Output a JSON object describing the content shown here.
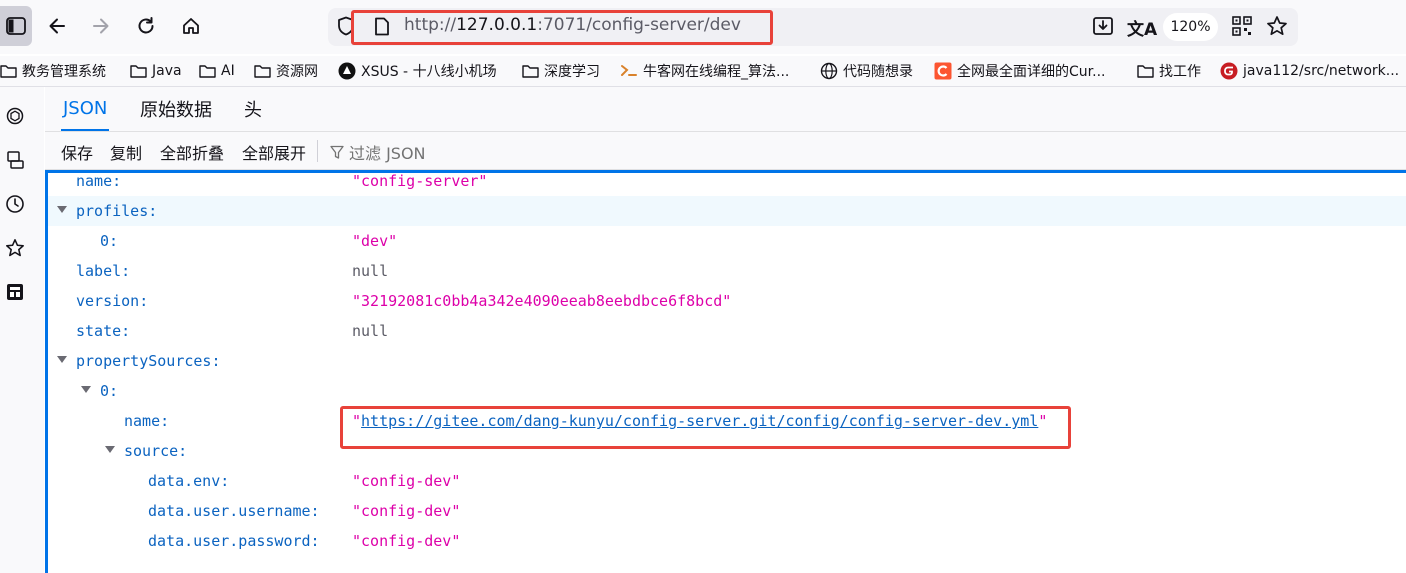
{
  "browser": {
    "url_prefix": "http://",
    "url_host": "127.0.0.1",
    "url_rest": ":7071/config-server/dev",
    "zoom": "120%"
  },
  "bookmarks": [
    {
      "label": "教务管理系统",
      "icon": "folder-icon"
    },
    {
      "label": "Java",
      "icon": "folder-icon"
    },
    {
      "label": "AI",
      "icon": "folder-icon"
    },
    {
      "label": "资源网",
      "icon": "folder-icon"
    },
    {
      "label": "XSUS - 十八线小机场",
      "icon": "xsus-logo-icon"
    },
    {
      "label": "深度学习",
      "icon": "folder-icon"
    },
    {
      "label": "牛客网在线编程_算法...",
      "icon": "nowcoder-icon"
    },
    {
      "label": "代码随想录",
      "icon": "globe-icon"
    },
    {
      "label": "全网最全面详细的Cur...",
      "icon": "csdn-icon"
    },
    {
      "label": "找工作",
      "icon": "folder-icon"
    },
    {
      "label": "java112/src/network...",
      "icon": "gitee-icon"
    }
  ],
  "viewer": {
    "tabs": [
      "JSON",
      "原始数据",
      "头"
    ],
    "actions": [
      "保存",
      "复制",
      "全部折叠",
      "全部展开"
    ],
    "filter_placeholder": "过滤 JSON"
  },
  "json_rows": [
    {
      "key": "name:",
      "value": "\"config-server\"",
      "type": "string",
      "depth": 0,
      "expandable": false
    },
    {
      "key": "profiles:",
      "value": "",
      "type": "none",
      "depth": 0,
      "expandable": true
    },
    {
      "key": "0:",
      "value": "\"dev\"",
      "type": "string",
      "depth": 1,
      "expandable": false
    },
    {
      "key": "label:",
      "value": "null",
      "type": "null",
      "depth": 0,
      "expandable": false
    },
    {
      "key": "version:",
      "value": "\"32192081c0bb4a342e4090eeab8eebdbce6f8bcd\"",
      "type": "string",
      "depth": 0,
      "expandable": false
    },
    {
      "key": "state:",
      "value": "null",
      "type": "null",
      "depth": 0,
      "expandable": false
    },
    {
      "key": "propertySources:",
      "value": "",
      "type": "none",
      "depth": 0,
      "expandable": true
    },
    {
      "key": "0:",
      "value": "",
      "type": "none",
      "depth": 1,
      "expandable": true
    },
    {
      "key": "name:",
      "value": "https://gitee.com/dang-kunyu/config-server.git/config/config-server-dev.yml",
      "type": "link",
      "depth": 2,
      "expandable": false
    },
    {
      "key": "source:",
      "value": "",
      "type": "none",
      "depth": 2,
      "expandable": true
    },
    {
      "key": "data.env:",
      "value": "\"config-dev\"",
      "type": "string",
      "depth": 3,
      "expandable": false
    },
    {
      "key": "data.user.username:",
      "value": "\"config-dev\"",
      "type": "string",
      "depth": 3,
      "expandable": false
    },
    {
      "key": "data.user.password:",
      "value": "\"config-dev\"",
      "type": "string",
      "depth": 3,
      "expandable": false
    }
  ],
  "colors": {
    "accent": "#0074e8",
    "highlight_box": "#e8423a",
    "string": "#dd00a9",
    "key": "#0b63c0"
  }
}
